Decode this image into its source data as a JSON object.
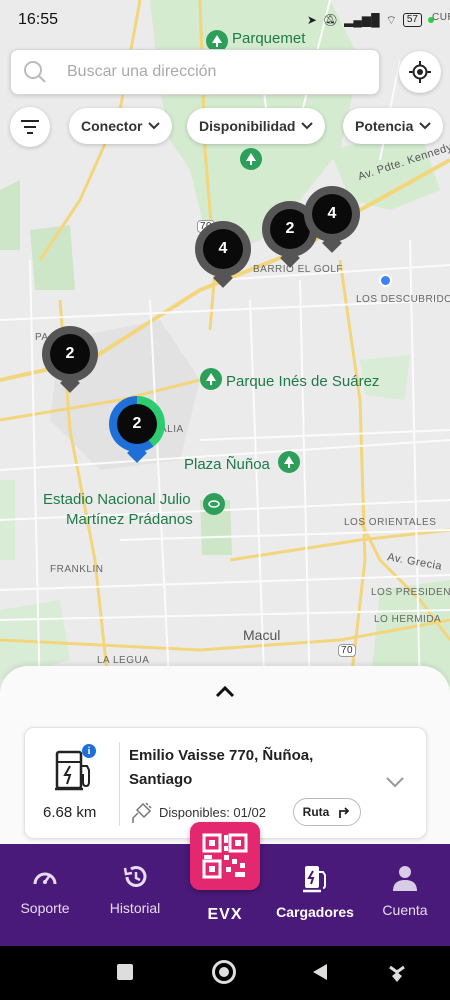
{
  "status_bar": {
    "time": "16:55",
    "battery": "57"
  },
  "search": {
    "placeholder": "Buscar una dirección"
  },
  "filters": {
    "chips": [
      {
        "label": "Conector"
      },
      {
        "label": "Disponibilidad"
      },
      {
        "label": "Potencia"
      }
    ]
  },
  "map": {
    "labels": {
      "parquemet": "Parquemet",
      "av_pdte_kennedy": "Av. Pdte. Kennedy",
      "barrio_el_golf": "BARRIO EL GOLF",
      "los_descubridores": "LOS DESCUBRIDO",
      "route_70_top": "70",
      "parque_ines": "Parque Inés de Suárez",
      "plaza_nunoa": "Plaza Ñuñoa",
      "estadio_line1": "Estadio Nacional Julio",
      "estadio_line2": "Martínez Prádanos",
      "los_orientales": "LOS ORIENTALES",
      "av_grecia": "Av. Grecia",
      "franklin": "FRANKLIN",
      "los_presidentes": "LOS PRESIDENTES",
      "lo_hermida": "LO HERMIDA",
      "macul": "Macul",
      "la_legua": "LA LEGUA",
      "route_70_bottom": "70",
      "pa_partial": "PA",
      "b_partial": "B",
      "alia_partial": "ALIA",
      "cur_partial": "CUR"
    },
    "markers": [
      {
        "count": "4"
      },
      {
        "count": "2"
      },
      {
        "count": "4"
      },
      {
        "count": "2"
      },
      {
        "count": "2"
      }
    ]
  },
  "card": {
    "distance": "6.68 km",
    "address": "Emilio Vaisse 770, Ñuñoa, Santiago",
    "availability": "Disponibles: 01/02",
    "route_label": "Ruta",
    "info": "i"
  },
  "nav": {
    "items": [
      {
        "label": "Soporte"
      },
      {
        "label": "Historial"
      },
      {
        "label": "Cargadores"
      },
      {
        "label": "Cuenta"
      }
    ],
    "brand": "EVX"
  },
  "colors": {
    "nav_bg": "#4a1a7a",
    "qr_accent": "#e3286f",
    "marker_grey": "#555555",
    "park_green": "#2e9e5b"
  }
}
